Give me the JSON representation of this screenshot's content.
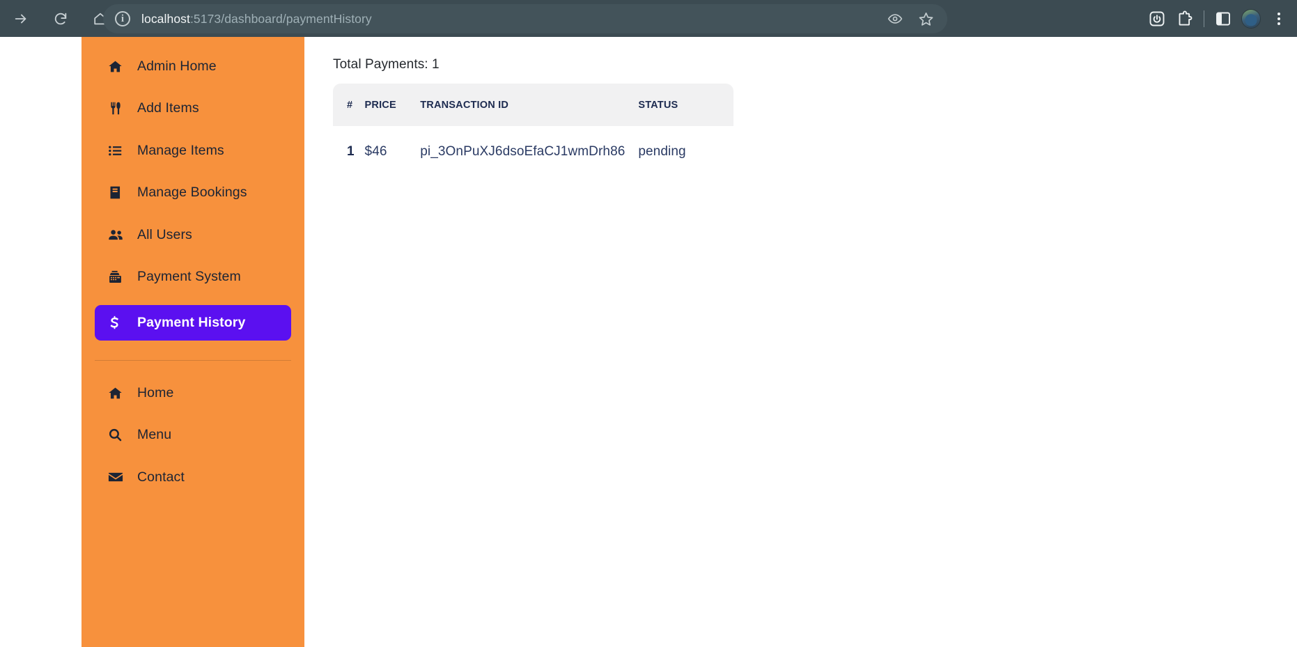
{
  "browser": {
    "url_host": "localhost",
    "url_rest": ":5173/dashboard/paymentHistory",
    "info_glyph": "i",
    "forward_icon": "forward-arrow-icon",
    "reload_icon": "reload-icon",
    "home_icon": "home-icon",
    "eye_icon": "eye-icon",
    "bookmark_icon": "star-icon",
    "power_icon": "power-icon",
    "extensions_icon": "extensions-icon",
    "sidepanel_icon": "side-panel-icon",
    "profile_icon": "profile-avatar",
    "menu_icon": "three-dot-menu-icon"
  },
  "sidebar": {
    "accent_orange": "#f7913d",
    "active_purple": "#5b10f0",
    "admin_items": [
      {
        "label": "Admin Home",
        "icon": "house-icon"
      },
      {
        "label": "Add Items",
        "icon": "utensils-icon"
      },
      {
        "label": "Manage Items",
        "icon": "list-icon"
      },
      {
        "label": "Manage Bookings",
        "icon": "book-icon"
      },
      {
        "label": "All Users",
        "icon": "users-icon"
      },
      {
        "label": "Payment System",
        "icon": "cash-register-icon"
      },
      {
        "label": "Payment History",
        "icon": "dollar-sign-icon",
        "active": true
      }
    ],
    "site_items": [
      {
        "label": "Home",
        "icon": "house-icon"
      },
      {
        "label": "Menu",
        "icon": "search-icon"
      },
      {
        "label": "Contact",
        "icon": "envelope-icon"
      }
    ]
  },
  "main": {
    "total_payments_label": "Total Payments: 1",
    "table": {
      "headers": [
        "#",
        "Price",
        "Transaction Id",
        "Status"
      ],
      "rows": [
        {
          "index": "1",
          "price": "$46",
          "transaction_id": "pi_3OnPuXJ6dsoEfaCJ1wmDrh86",
          "status": "pending"
        }
      ]
    }
  }
}
